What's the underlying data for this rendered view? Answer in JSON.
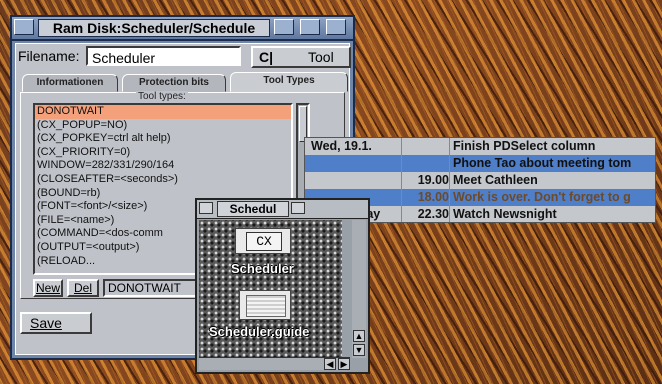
{
  "info_window": {
    "title": "Ram Disk:Scheduler/Schedule",
    "filename_label": "Filename:",
    "filename_value": "Scheduler",
    "tool_button_label": "Tool",
    "tool_button_arrow": "C|",
    "tabs": [
      {
        "label": "Informationen",
        "active": false
      },
      {
        "label": "Protection bits",
        "active": false
      },
      {
        "label": "Tool Types",
        "active": true
      }
    ],
    "tooltypes_legend": "Tool types:",
    "tooltypes": [
      "DONOTWAIT",
      "(CX_POPUP=NO)",
      "(CX_POPKEY=ctrl alt help)",
      "(CX_PRIORITY=0)",
      "WINDOW=282/331/290/164",
      "(CLOSEAFTER=<seconds>)",
      "(BOUND=rb)",
      "(FONT=<font>/<size>)",
      "(FILE=<name>)",
      "(COMMAND=<dos-comm",
      "(OUTPUT=<output>)",
      "(RELOAD..."
    ],
    "selected_index": 0,
    "new_label": "New",
    "del_label": "Del",
    "edit_value": "DONOTWAIT",
    "save_label": "Save"
  },
  "calendar": {
    "rows": [
      {
        "day": "Wed, 19.1.",
        "time": "",
        "event": "Finish PDSelect column",
        "style": "plain"
      },
      {
        "day": "",
        "time": "",
        "event": "Phone Tao about meeting tom",
        "style": "blue"
      },
      {
        "day": "",
        "time": "19.00",
        "event": "Meet Cathleen",
        "style": "plain"
      },
      {
        "day": "",
        "time": "18.00",
        "event": "Work is over. Don't forget to g",
        "style": "blue"
      },
      {
        "day": "Wednesday",
        "time": "22.30",
        "event": "Watch Newsnight",
        "style": "plain"
      }
    ]
  },
  "drawer": {
    "title": "Schedul",
    "icons": [
      {
        "label": "Scheduler",
        "glyph": "CX",
        "icon": "commodity-icon"
      },
      {
        "label": "Scheduler.guide",
        "icon": "guide-document-icon"
      }
    ]
  },
  "colors": {
    "title_bar": "#6f86a8",
    "window_bg": "#bfc3c9",
    "selection": "#f4a07a",
    "calendar_highlight": "#4f7fc9"
  }
}
